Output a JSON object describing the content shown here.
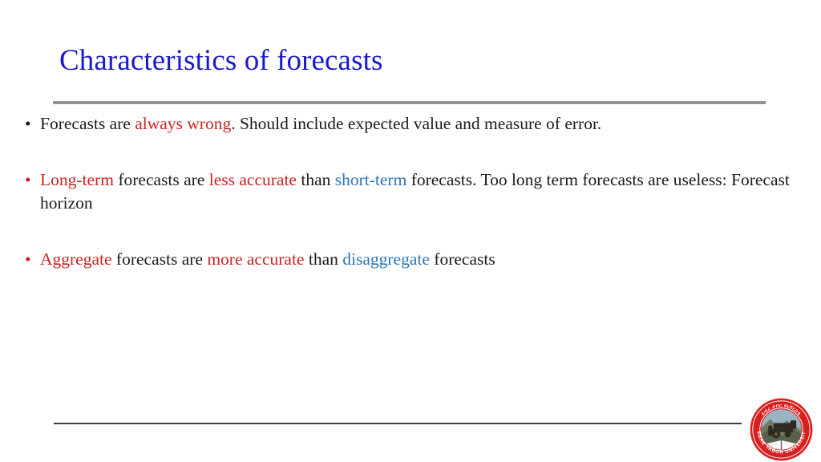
{
  "slide": {
    "title": "Characteristics of forecasts",
    "background_color": "#ffffff",
    "title_color": "#1a1acc",
    "emphasis_red": "#cc2222",
    "emphasis_blue": "#2e75b6",
    "body_color": "#1b1b1b",
    "rule_color": "#8a8a8a",
    "bottom_rule_color": "#3d3d3d"
  },
  "bullets": [
    {
      "marker": "•",
      "marker_color": "#1b1b1b",
      "runs": [
        {
          "text": "Forecasts are ",
          "style": "plain"
        },
        {
          "text": "always wrong",
          "style": "red"
        },
        {
          "text": ". Should include expected value and measure of error.",
          "style": "plain"
        }
      ]
    },
    {
      "marker": "•",
      "marker_color": "#cc2222",
      "runs": [
        {
          "text": "Long-term",
          "style": "red"
        },
        {
          "text": " forecasts are ",
          "style": "plain"
        },
        {
          "text": "less accurate",
          "style": "red"
        },
        {
          "text": " than ",
          "style": "plain"
        },
        {
          "text": "short-term",
          "style": "blue"
        },
        {
          "text": " forecasts. Too long term forecasts are useless: Forecast horizon",
          "style": "plain"
        }
      ]
    },
    {
      "marker": "•",
      "marker_color": "#cc2222",
      "runs": [
        {
          "text": "Aggregate",
          "style": "red"
        },
        {
          "text": " forecasts are ",
          "style": "plain"
        },
        {
          "text": "more accurate",
          "style": "red"
        },
        {
          "text": " than ",
          "style": "plain"
        },
        {
          "text": "disaggregate",
          "style": "blue"
        },
        {
          "text": " forecasts",
          "style": "plain"
        }
      ]
    }
  ],
  "logo": {
    "name": "debre-tabor-university-seal",
    "ring_text_bottom": "DEBRE TABOR UNIVERSITY",
    "ring_text_top": "ደብረ ታቦር ዩኒቭርስቲ",
    "ring_color": "#d81f20",
    "ring_text_color": "#ffffff"
  }
}
